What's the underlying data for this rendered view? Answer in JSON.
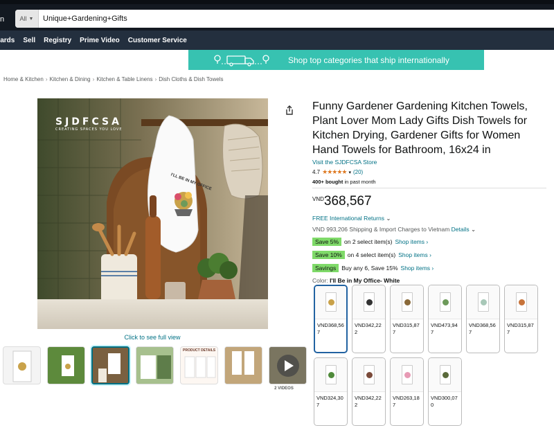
{
  "header": {
    "logo_fragment": "n",
    "search": {
      "category": "All",
      "value": "Unique+Gardening+Gifts"
    }
  },
  "nav": {
    "items": [
      "Cards",
      "Sell",
      "Registry",
      "Prime Video",
      "Customer Service"
    ]
  },
  "banner": {
    "text": "Shop top categories that ship internationally"
  },
  "breadcrumbs": [
    "Home & Kitchen",
    "Kitchen & Dining",
    "Kitchen & Table Linens",
    "Dish Cloths & Dish Towels"
  ],
  "gallery": {
    "brand_text": "SJDFCSA",
    "brand_tagline": "CREATING SPACES YOU LOVE",
    "towel_text": "I'LL BE IN MY OFFICE",
    "see_full_view": "Click to see full view",
    "thumb_labels": [
      "",
      "",
      "",
      "",
      "PRODUCT DETAILS",
      "",
      ""
    ],
    "videos_label": "2 VIDEOS"
  },
  "product": {
    "title": "Funny Gardener Gardening Kitchen Towels, Plant Lover Mom Lady Gifts Dish Towels for Kitchen Drying, Gardener Gifts for Women Hand Towels for Bathroom, 16x24 in",
    "store_link": "Visit the SJDFCSA Store",
    "rating": "4.7",
    "stars": "★★★★★",
    "rating_count": "(20)",
    "bought_strong": "400+ bought",
    "bought_rest": " in past month",
    "price_currency": "VND",
    "price_amount": "368,567",
    "returns": "FREE International Returns",
    "shipping": "VND 993,206 Shipping & Import Charges to Vietnam",
    "details_link": "Details",
    "promos": [
      {
        "badge": "Save 5%",
        "text": "on 2 select item(s)",
        "link": "Shop items ›"
      },
      {
        "badge": "Save 10%",
        "text": "on 4 select item(s)",
        "link": "Shop items ›"
      },
      {
        "badge": "Savings",
        "text": "Buy any 6, Save 15%",
        "link": "Shop items ›"
      }
    ],
    "color_label": "Color:",
    "color_value": "I'll Be in My Office- White"
  },
  "swatches": [
    {
      "price": "VND368,567",
      "accent": "#c9a24a",
      "selected": true
    },
    {
      "price": "VND342,222",
      "accent": "#333333",
      "selected": false
    },
    {
      "price": "VND315,877",
      "accent": "#8a6a3a",
      "selected": false
    },
    {
      "price": "VND473,947",
      "accent": "#6d9a5a",
      "selected": false
    },
    {
      "price": "VND368,567",
      "accent": "#a8c8b8",
      "selected": false
    },
    {
      "price": "VND315,877",
      "accent": "#c7733a",
      "selected": false
    },
    {
      "price": "VND324,307",
      "accent": "#4f8a3a",
      "selected": false
    },
    {
      "price": "VND342,222",
      "accent": "#7a4a3a",
      "selected": false
    },
    {
      "price": "VND263,187",
      "accent": "#e79ab4",
      "selected": false
    },
    {
      "price": "VND300,070",
      "accent": "#5a6a3a",
      "selected": false
    }
  ]
}
